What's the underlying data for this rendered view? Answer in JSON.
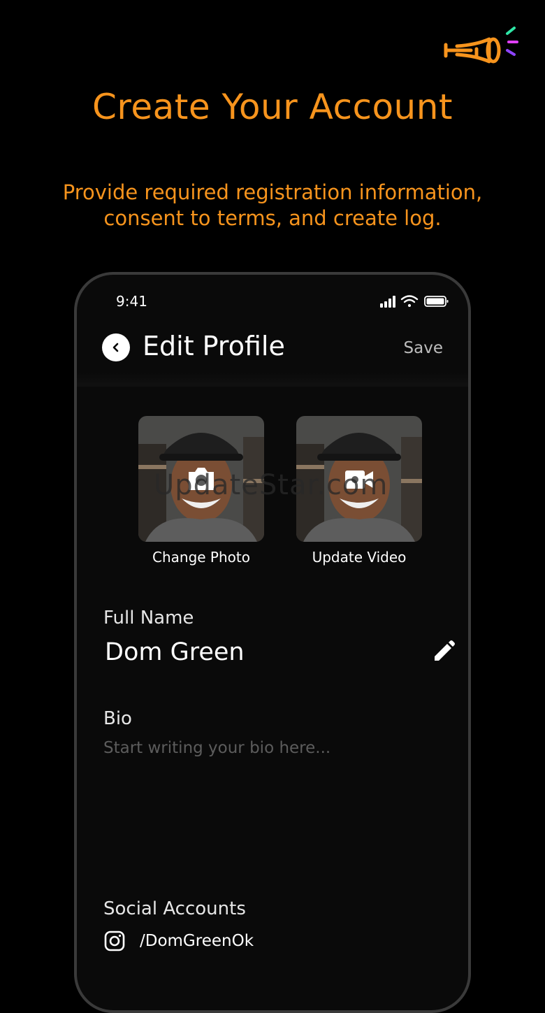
{
  "promo": {
    "title": "Create Your Account",
    "subtitle": "Provide required registration information, consent to terms, and create log."
  },
  "logo": {
    "icon": "horn-logo-icon",
    "color": "#f7941d"
  },
  "status_bar": {
    "time": "9:41"
  },
  "nav": {
    "title": "Edit Profile",
    "save_label": "Save"
  },
  "media": {
    "photo_label": "Change Photo",
    "video_label": "Update Video",
    "watermark": "UpdateStar.com"
  },
  "form": {
    "full_name_label": "Full Name",
    "full_name_value": "Dom Green",
    "bio_label": "Bio",
    "bio_placeholder": "Start writing your bio here...",
    "social_label": "Social Accounts",
    "instagram_handle": "/DomGreenOk"
  },
  "colors": {
    "accent": "#f7941d",
    "background": "#000000",
    "phone_bg": "#0a0a0a"
  }
}
